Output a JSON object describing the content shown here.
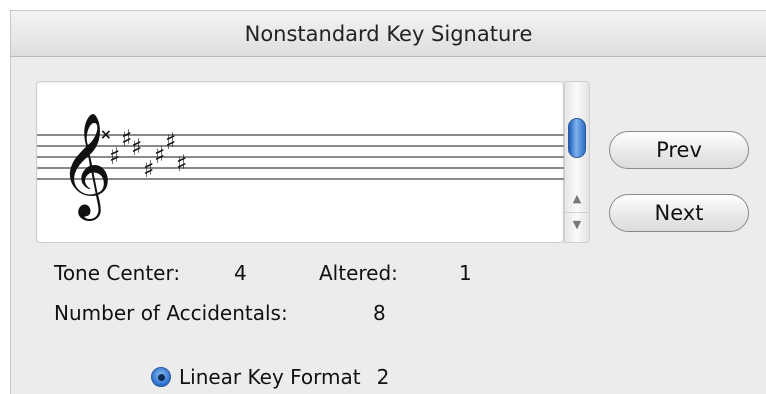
{
  "window": {
    "title": "Nonstandard Key Signature"
  },
  "buttons": {
    "prev": "Prev",
    "next": "Next"
  },
  "info": {
    "tone_center_label": "Tone Center:",
    "tone_center_value": "4",
    "altered_label": "Altered:",
    "altered_value": "1",
    "accidentals_label": "Number of Accidentals:",
    "accidentals_value": "8"
  },
  "format": {
    "label": "Linear Key Format",
    "value": "2",
    "selected": true
  },
  "staff": {
    "clef": "treble-clef",
    "accidentals": [
      "double-sharp",
      "sharp",
      "sharp",
      "sharp",
      "sharp",
      "sharp",
      "sharp",
      "sharp"
    ]
  },
  "colors": {
    "accent": "#2a6fcf"
  }
}
